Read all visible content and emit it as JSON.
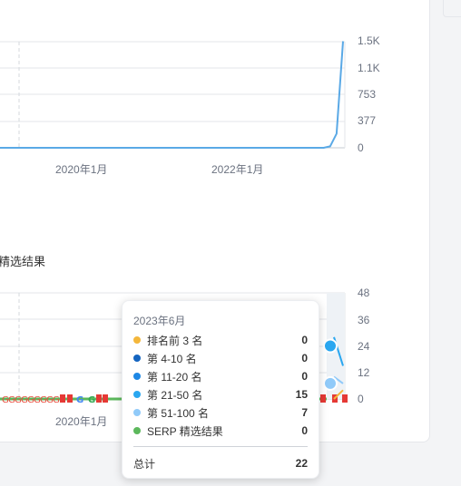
{
  "chart_data": [
    {
      "type": "line",
      "title": "",
      "xlabel": "",
      "ylabel": "",
      "y_ticks": [
        "1.5K",
        "1.1K",
        "753",
        "377",
        "0"
      ],
      "ylim": [
        0,
        1500
      ],
      "x_ticks": [
        "2020年1月",
        "2022年1月"
      ],
      "grid": true,
      "series": [
        {
          "name": "",
          "color": "#5aa9e6",
          "points": [
            [
              "2018-12",
              0
            ],
            [
              "2022-01",
              0
            ],
            [
              "2023-03",
              0
            ],
            [
              "2023-04",
              20
            ],
            [
              "2023-05",
              200
            ],
            [
              "2023-06",
              1506
            ]
          ]
        }
      ]
    },
    {
      "type": "line",
      "title": "精选结果",
      "y_ticks": [
        "48",
        "36",
        "24",
        "12",
        "0"
      ],
      "ylim": [
        0,
        48
      ],
      "x_ticks": [
        "2020年1月"
      ],
      "grid": true,
      "series": [
        {
          "name": "排名前 3 名",
          "color": "#f4b73b",
          "values_last": [
            0,
            4
          ]
        },
        {
          "name": "第 4-10 名",
          "color": "#1565c0",
          "values_last": [
            0,
            0
          ]
        },
        {
          "name": "第 11-20 名",
          "color": "#1e88e5",
          "values_last": [
            0,
            0
          ]
        },
        {
          "name": "第 21-50 名",
          "color": "#2aa7f0",
          "values_last": [
            28,
            15
          ]
        },
        {
          "name": "第 51-100 名",
          "color": "#90caf9",
          "values_last": [
            10,
            7
          ]
        },
        {
          "name": "SERP 精选结果",
          "color": "#5cb85c",
          "values_last": [
            0,
            0
          ]
        }
      ]
    }
  ],
  "section2": {
    "title": "精选结果"
  },
  "tooltip": {
    "date": "2023年6月",
    "rows": [
      {
        "label": "排名前 3 名",
        "value": "0",
        "color": "#f4b73b"
      },
      {
        "label": "第 4-10 名",
        "value": "0",
        "color": "#1565c0"
      },
      {
        "label": "第 11-20 名",
        "value": "0",
        "color": "#1e88e5"
      },
      {
        "label": "第 21-50 名",
        "value": "15",
        "color": "#2aa7f0"
      },
      {
        "label": "第 51-100 名",
        "value": "7",
        "color": "#90caf9"
      },
      {
        "label": "SERP 精选结果",
        "value": "0",
        "color": "#5cb85c"
      }
    ],
    "total_label": "总计",
    "total_value": "22"
  }
}
